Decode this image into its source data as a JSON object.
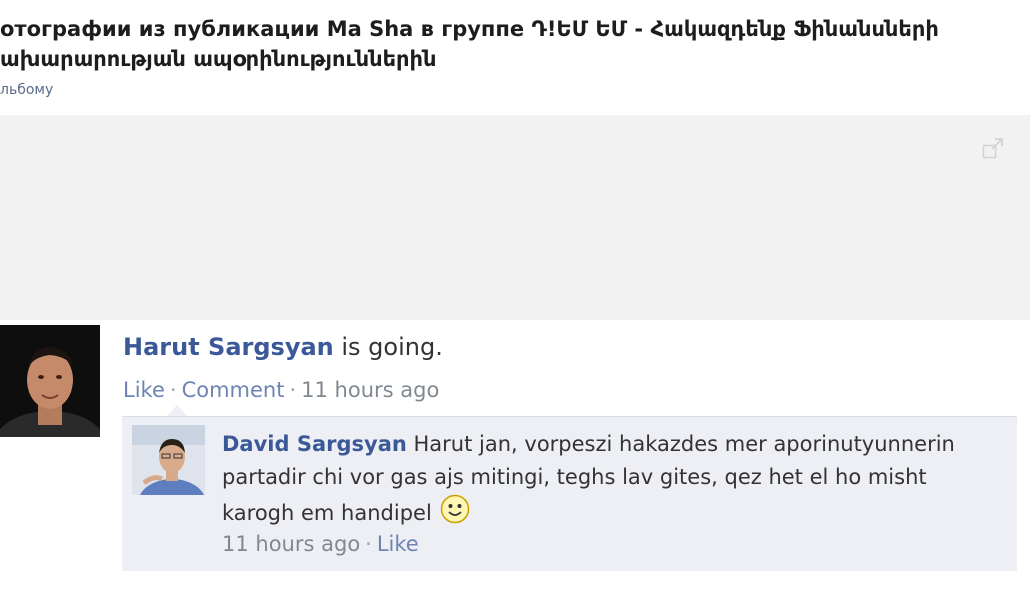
{
  "header": {
    "title_line1": "отографии из публикации Ma Sha в группе Դ!ԵՄ ԵՄ - Հակազդենք Ֆինանսների",
    "title_line2": "ախարարության ապօրինություններին",
    "album_link": "льбому"
  },
  "comment": {
    "author": "Harut Sargsyan",
    "text": " is going.",
    "like": "Like",
    "comment": "Comment",
    "time": "11 hours ago"
  },
  "reply": {
    "author": "David Sargsyan",
    "text": "Harut jan, vorpeszi hakazdes mer aporinutyunnerin partadir chi vor gas ajs mitingi, teghs lav gites, qez het el ho misht karogh em handipel",
    "emoticon": "smiley-icon",
    "time": "11 hours ago",
    "like": "Like"
  },
  "colors": {
    "link": "#3b5998",
    "meta": "#808890",
    "reply_bg": "#edeff4",
    "photo_bg": "#f2f2f2"
  }
}
